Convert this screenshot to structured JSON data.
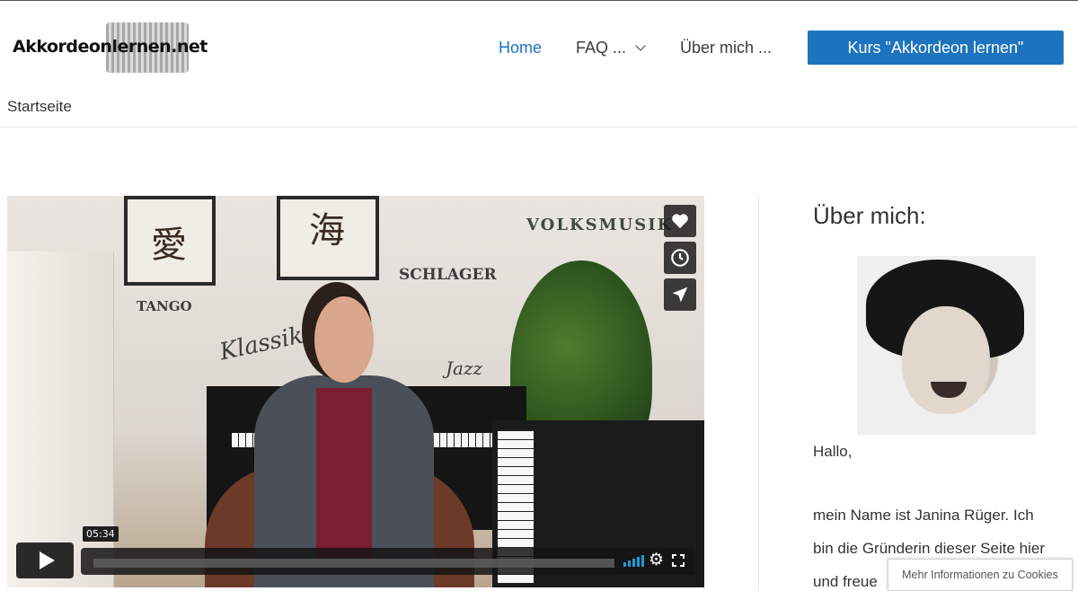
{
  "header": {
    "logo_text": "Akkordeonlernen.net",
    "nav": [
      {
        "label": "Home",
        "active": true
      },
      {
        "label": "FAQ ...",
        "has_dropdown": true
      },
      {
        "label": "Über mich ..."
      }
    ],
    "cta_label": "Kurs \"Akkordeon lernen\""
  },
  "breadcrumb": "Startseite",
  "video": {
    "wall_words": [
      "VOLKSMUSIK",
      "SCHLAGER",
      "TANGO",
      "Klassik",
      "Jazz"
    ],
    "kanji": [
      "愛",
      "海"
    ],
    "time": "05:34",
    "side_icons": [
      "heart-icon",
      "clock-icon",
      "send-icon"
    ]
  },
  "sidebar": {
    "title": "Über mich:",
    "greeting": "Hallo,",
    "paragraph_lines": [
      "mein Name ist Janina Rüger. Ich",
      "bin die Gründerin dieser Seite hier",
      "und freue"
    ]
  },
  "cookie_notice": "Mehr Informationen zu Cookies",
  "colors": {
    "accent": "#1e73be",
    "text": "#333333"
  }
}
